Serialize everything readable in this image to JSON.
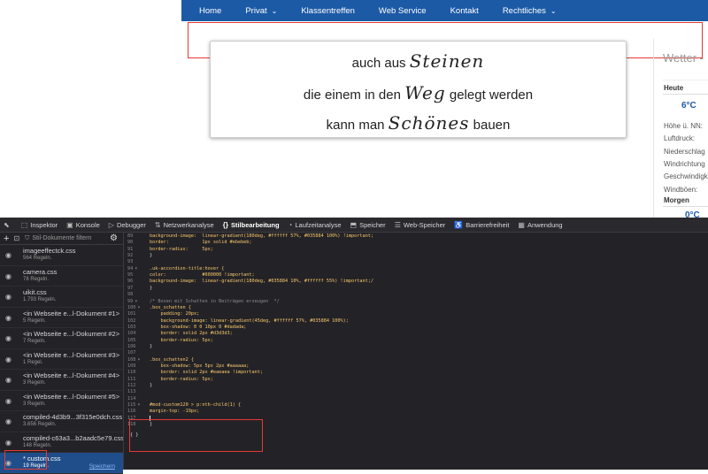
{
  "nav": {
    "items": [
      {
        "label": "Home",
        "dropdown": false
      },
      {
        "label": "Privat",
        "dropdown": true
      },
      {
        "label": "Klassentreffen",
        "dropdown": false
      },
      {
        "label": "Web Service",
        "dropdown": false
      },
      {
        "label": "Kontakt",
        "dropdown": false
      },
      {
        "label": "Rechtliches",
        "dropdown": true
      }
    ],
    "bg_color": "#1c5aa6"
  },
  "quote": {
    "line1_prefix": "auch aus",
    "line1_script": "Steinen",
    "line2_prefix": "die einem in den",
    "line2_script": "Weg",
    "line2_suffix": "gelegt werden",
    "line3_prefix": "kann man",
    "line3_script": "Schönes",
    "line3_suffix": "bauen"
  },
  "weather": {
    "title": "Wetter -",
    "today_label": "Heute",
    "today_temp": "6°C",
    "rows": [
      "Höhe ü. NN:",
      "Luftdruck:",
      "Niederschlag",
      "Windrichtung",
      "Geschwindigk",
      "Windböen:"
    ],
    "tomorrow_label": "Morgen",
    "tomorrow_temp": "0°C"
  },
  "devtools": {
    "tabs": [
      {
        "icon": "⬚",
        "label": "Inspektor",
        "active": false
      },
      {
        "icon": "▣",
        "label": "Konsole",
        "active": false
      },
      {
        "icon": "▷",
        "label": "Debugger",
        "active": false
      },
      {
        "icon": "⇅",
        "label": "Netzwerkanalyse",
        "active": false
      },
      {
        "icon": "{}",
        "label": "Stilbearbeitung",
        "active": true
      },
      {
        "icon": "◔",
        "label": "Laufzeitanalyse",
        "active": false
      },
      {
        "icon": "⬒",
        "label": "Speicher",
        "active": false
      },
      {
        "icon": "☰",
        "label": "Web-Speicher",
        "active": false
      },
      {
        "icon": "♿",
        "label": "Barrierefreiheit",
        "active": false
      },
      {
        "icon": "▦",
        "label": "Anwendung",
        "active": false
      }
    ],
    "filter_placeholder": "Stil-Dokumente filtern",
    "sheets": [
      {
        "name": "imageeffectck.css",
        "rules": "564 Regeln.",
        "selected": false
      },
      {
        "name": "camera.css",
        "rules": "78 Regeln.",
        "selected": false
      },
      {
        "name": "uikit.css",
        "rules": "1.793 Regeln.",
        "selected": false
      },
      {
        "name": "<in Webseite e...l-Dokument #1>",
        "rules": "5 Regeln.",
        "selected": false
      },
      {
        "name": "<in Webseite e...l-Dokument #2>",
        "rules": "7 Regeln.",
        "selected": false
      },
      {
        "name": "<in Webseite e...l-Dokument #3>",
        "rules": "1 Regel.",
        "selected": false
      },
      {
        "name": "<in Webseite e...l-Dokument #4>",
        "rules": "3 Regeln.",
        "selected": false
      },
      {
        "name": "<in Webseite e...l-Dokument #5>",
        "rules": "3 Regeln.",
        "selected": false
      },
      {
        "name": "compiled-4d3b9...3f315e0dch.css",
        "rules": "3.656 Regeln.",
        "selected": false
      },
      {
        "name": "compiled-c63a3...b2aadc5e79.css",
        "rules": "148 Regeln.",
        "selected": false
      },
      {
        "name": "* custom.css",
        "rules": "19 Regeln.",
        "selected": true
      }
    ],
    "save_label": "Speichern",
    "code_lines": [
      {
        "n": "89",
        "fold": "",
        "text": "background-image:  linear-gradient(180deg, #ffffff 57%, #035884 100%) !important;",
        "cls": "k"
      },
      {
        "n": "90",
        "fold": "",
        "text": "border:            1px solid #ebebeb;",
        "cls": "k"
      },
      {
        "n": "91",
        "fold": "",
        "text": "border-radius:     5px;",
        "cls": "k"
      },
      {
        "n": "92",
        "fold": "",
        "text": "}",
        "cls": "n"
      },
      {
        "n": "93",
        "fold": "",
        "text": "",
        "cls": "n"
      },
      {
        "n": "94",
        "fold": "▾",
        "text": ".uk-accordion-title:hover {",
        "cls": "sel-c"
      },
      {
        "n": "95",
        "fold": "",
        "text": "color:             #000000 !important;",
        "cls": "k"
      },
      {
        "n": "96",
        "fold": "",
        "text": "background-image:  linear-gradient(180deg, #035884 10%, #ffffff 55%) !important;/",
        "cls": "k"
      },
      {
        "n": "97",
        "fold": "",
        "text": "}",
        "cls": "n"
      },
      {
        "n": "98",
        "fold": "",
        "text": "",
        "cls": "n"
      },
      {
        "n": "99",
        "fold": "▾",
        "text": "/* Boxen mit Schatten in Beiträgen erzeugen  */",
        "cls": "cm"
      },
      {
        "n": "100",
        "fold": "▾",
        "text": ".box_schatten {",
        "cls": "sel-c"
      },
      {
        "n": "101",
        "fold": "",
        "text": "    padding: 20px;",
        "cls": "k"
      },
      {
        "n": "102",
        "fold": "",
        "text": "    background-image: linear-gradient(45deg, #ffffff 57%, #035884 100%);",
        "cls": "k"
      },
      {
        "n": "103",
        "fold": "",
        "text": "    box-shadow: 0 0 10px 0 #dadada;",
        "cls": "k"
      },
      {
        "n": "104",
        "fold": "",
        "text": "    border: solid 2px #d3d3d3;",
        "cls": "k"
      },
      {
        "n": "105",
        "fold": "",
        "text": "    border-radius: 5px;",
        "cls": "k"
      },
      {
        "n": "106",
        "fold": "",
        "text": "}",
        "cls": "n"
      },
      {
        "n": "107",
        "fold": "",
        "text": "",
        "cls": "n"
      },
      {
        "n": "108",
        "fold": "▾",
        "text": ".box_schatten2 {",
        "cls": "sel-c"
      },
      {
        "n": "109",
        "fold": "",
        "text": "    box-shadow: 5px 5px 2px #aaaaaa;",
        "cls": "k"
      },
      {
        "n": "110",
        "fold": "",
        "text": "    border: solid 2px #eaeaea !important;",
        "cls": "k"
      },
      {
        "n": "111",
        "fold": "",
        "text": "    border-radius: 5px;",
        "cls": "k"
      },
      {
        "n": "112",
        "fold": "",
        "text": "}",
        "cls": "n"
      },
      {
        "n": "113",
        "fold": "",
        "text": "",
        "cls": "n"
      },
      {
        "n": "114",
        "fold": "",
        "text": "",
        "cls": "n"
      },
      {
        "n": "115",
        "fold": "▾",
        "text": "#mod-custom120 > p:nth-child(1) {",
        "cls": "sel-c"
      },
      {
        "n": "116",
        "fold": "",
        "text": "margin-top: -19px;",
        "cls": "k"
      },
      {
        "n": "117",
        "fold": "",
        "text": "",
        "cls": "n"
      },
      {
        "n": "118",
        "fold": "",
        "text": "}",
        "cls": "n"
      }
    ],
    "code_tail": "{ }"
  }
}
